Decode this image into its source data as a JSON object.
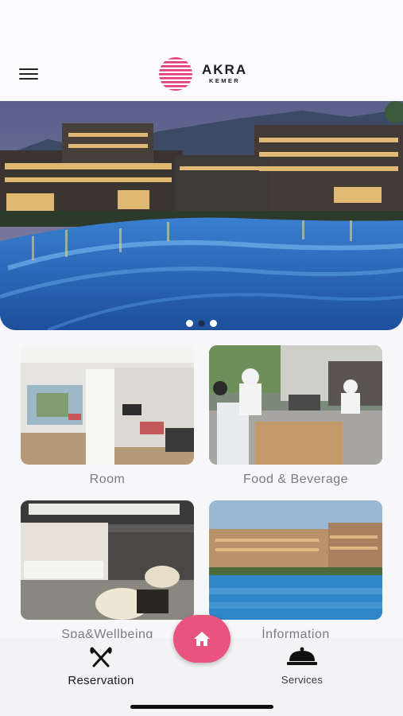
{
  "header": {
    "menu_icon": "hamburger-menu-icon",
    "logo": {
      "name": "AKRA",
      "sub": "KEMER",
      "mark_color": "#e3397a"
    }
  },
  "carousel": {
    "slide_count": 3,
    "active_index": 1
  },
  "categories": [
    {
      "label": "Room",
      "image": "room-photo"
    },
    {
      "label": "Food & Beverage",
      "image": "food-photo"
    },
    {
      "label": "Spa&Wellbeing",
      "image": "spa-photo"
    },
    {
      "label": "İnformation",
      "image": "information-photo"
    }
  ],
  "bottom_nav": {
    "reservation": {
      "label": "Reservation",
      "icon": "fork-knife-icon"
    },
    "home": {
      "icon": "home-icon",
      "color": "#e8547e"
    },
    "services": {
      "label": "Services",
      "icon": "service-bell-icon"
    }
  }
}
